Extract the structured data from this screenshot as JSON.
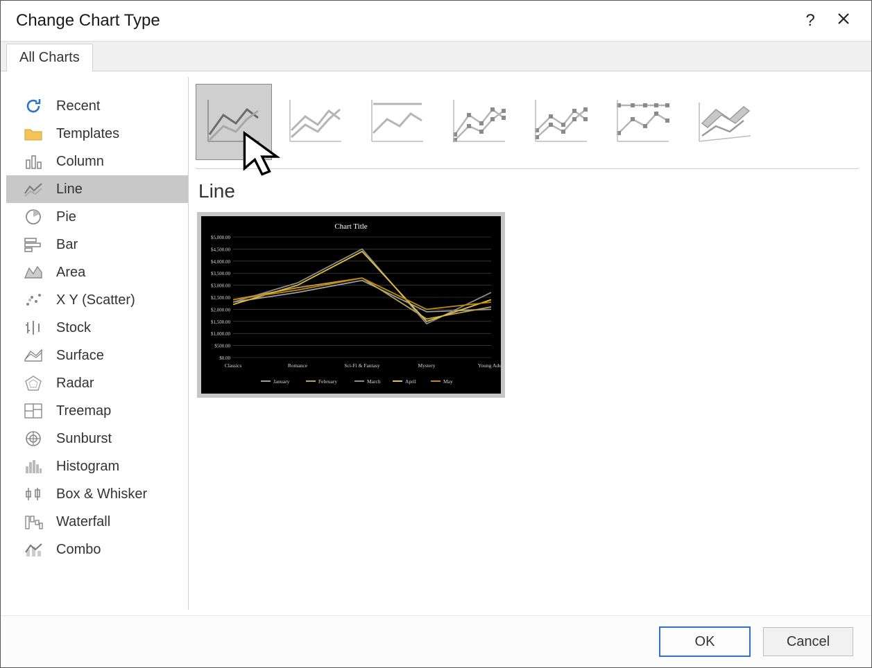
{
  "dialog": {
    "title": "Change Chart Type"
  },
  "tabs": {
    "all_charts": "All Charts"
  },
  "sidebar": {
    "items": [
      {
        "label": "Recent"
      },
      {
        "label": "Templates"
      },
      {
        "label": "Column"
      },
      {
        "label": "Line"
      },
      {
        "label": "Pie"
      },
      {
        "label": "Bar"
      },
      {
        "label": "Area"
      },
      {
        "label": "X Y (Scatter)"
      },
      {
        "label": "Stock"
      },
      {
        "label": "Surface"
      },
      {
        "label": "Radar"
      },
      {
        "label": "Treemap"
      },
      {
        "label": "Sunburst"
      },
      {
        "label": "Histogram"
      },
      {
        "label": "Box & Whisker"
      },
      {
        "label": "Waterfall"
      },
      {
        "label": "Combo"
      }
    ],
    "selected_index": 3
  },
  "subtypes": {
    "names": [
      "Line",
      "Stacked Line",
      "100% Stacked Line",
      "Line with Markers",
      "Stacked Line with Markers",
      "100% Stacked Line with Markers",
      "3-D Line"
    ],
    "selected_index": 0
  },
  "content": {
    "heading": "Line"
  },
  "buttons": {
    "ok": "OK",
    "cancel": "Cancel"
  },
  "chart_data": {
    "type": "line",
    "title": "Chart Title",
    "categories": [
      "Classics",
      "Romance",
      "Sci-Fi & Fantasy",
      "Mystery",
      "Young Adult"
    ],
    "series": [
      {
        "name": "January",
        "color": "#9aa0a6",
        "values": [
          2300,
          2700,
          3200,
          1900,
          2000
        ]
      },
      {
        "name": "February",
        "color": "#bfa24a",
        "values": [
          2400,
          2900,
          3300,
          1600,
          2100
        ]
      },
      {
        "name": "March",
        "color": "#8c8c8c",
        "values": [
          2300,
          3100,
          4500,
          1400,
          2700
        ]
      },
      {
        "name": "April",
        "color": "#e4c13a",
        "values": [
          2200,
          3000,
          4400,
          1500,
          2400
        ]
      },
      {
        "name": "May",
        "color": "#c28a00",
        "values": [
          2400,
          2800,
          3300,
          2000,
          2300
        ]
      }
    ],
    "ylabel": "",
    "xlabel": "",
    "ylim": [
      0,
      5000
    ],
    "y_ticks": [
      "$0.00",
      "$500.00",
      "$1,000.00",
      "$1,500.00",
      "$2,000.00",
      "$2,500.00",
      "$3,000.00",
      "$3,500.00",
      "$4,000.00",
      "$4,500.00",
      "$5,000.00"
    ]
  }
}
